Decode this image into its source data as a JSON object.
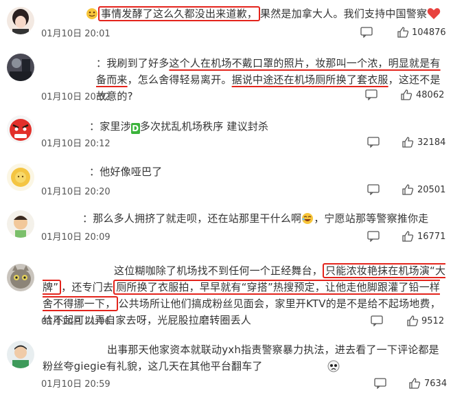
{
  "comments": [
    {
      "username": "",
      "text_parts": [
        "事情发酵了这么久都没出来道歉，",
        "果然是加拿大人。我们支持中国警察"
      ],
      "time": "01月10日 20:01",
      "likes": "104876"
    },
    {
      "username": "",
      "text_parts": [
        "：我刷到了好多",
        "这个人在机场不戴口罩的照片，妆那叫一个浓，明显就是有备而来",
        "，怎么舍得轻易离开。",
        "据说中途还在机场厕所换了套衣服",
        "，这还不是故意的?"
      ],
      "time": "01月10日 20:02",
      "likes": "48062"
    },
    {
      "username": "",
      "text_parts": [
        "：家里涉",
        "D",
        "多次扰乱机场秩序 建议封杀"
      ],
      "time": "01月10日 20:12",
      "likes": "32184"
    },
    {
      "username": "",
      "text_parts": [
        "：他好像哑巴了"
      ],
      "time": "01月10日 20:20",
      "likes": "20501"
    },
    {
      "username": "",
      "text_parts": [
        "：那么多人拥挤了就走呗，还在站那里干什么啊",
        "，宁愿站那等警察推你走"
      ],
      "time": "01月10日 20:09",
      "likes": "16771"
    },
    {
      "username": "",
      "text_parts": [
        "这位糊咖除了机场找不到任何一个正经舞台，",
        "只能浓妆艳抹在机场演“大牌”",
        "，还专门去",
        "厕所换了衣服拍，早早就有“穿搭”热搜预定，让他走他脚跟灌了铅一样舍不得挪一下，",
        "公共场所让他们搞成粉丝见面会，家里开KTV的是不是给不起场地费，给不起可以弄自家去呀，光屁股拉磨转圈丢人"
      ],
      "time": "01月10日 21:06",
      "likes": "9512"
    },
    {
      "username": "",
      "text_parts": [
        "出事那天他家资本就联动yxh指责警察暴力执法，进去看了一下评论都是粉丝夸giegie有礼貌，这几天在其他平台翻车了"
      ],
      "time": "01月10日 20:59",
      "likes": "7634"
    }
  ],
  "colors": {
    "accent": "#e3231b",
    "heart": "#e8423f",
    "meta": "#555555"
  }
}
